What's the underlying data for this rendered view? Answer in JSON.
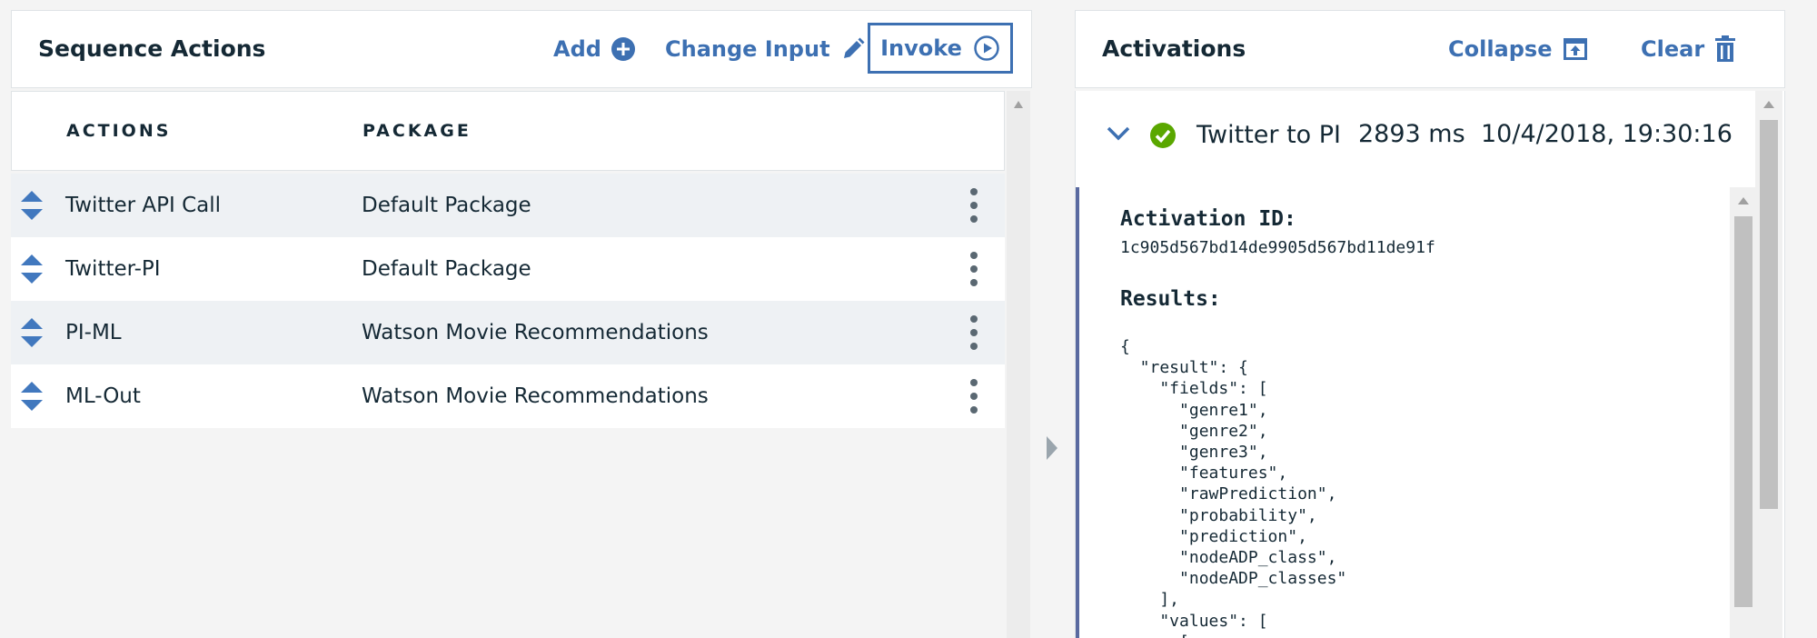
{
  "sequence": {
    "title": "Sequence Actions",
    "add_label": "Add",
    "change_input_label": "Change Input",
    "invoke_label": "Invoke",
    "columns": {
      "actions": "ACTIONS",
      "package": "PACKAGE"
    },
    "rows": [
      {
        "action": "Twitter API Call",
        "package": "Default Package"
      },
      {
        "action": "Twitter-PI",
        "package": "Default Package"
      },
      {
        "action": "PI-ML",
        "package": "Watson Movie Recommendations"
      },
      {
        "action": "ML-Out",
        "package": "Watson Movie Recommendations"
      }
    ]
  },
  "activations": {
    "title": "Activations",
    "collapse_label": "Collapse",
    "clear_label": "Clear",
    "item": {
      "name": "Twitter to PI",
      "duration": "2893 ms",
      "date": "10/4/2018, 19:30:16",
      "status": "success",
      "id_label": "Activation ID:",
      "id_value": "1c905d567bd14de9905d567bd11de91f",
      "results_label": "Results:",
      "results_json": "{\n  \"result\": {\n    \"fields\": [\n      \"genre1\",\n      \"genre2\",\n      \"genre3\",\n      \"features\",\n      \"rawPrediction\",\n      \"probability\",\n      \"prediction\",\n      \"nodeADP_class\",\n      \"nodeADP_classes\"\n    ],\n    \"values\": [\n      ["
    }
  },
  "colors": {
    "accent": "#3d70b2",
    "success": "#5aa700",
    "drag_icon": "#4178be"
  }
}
